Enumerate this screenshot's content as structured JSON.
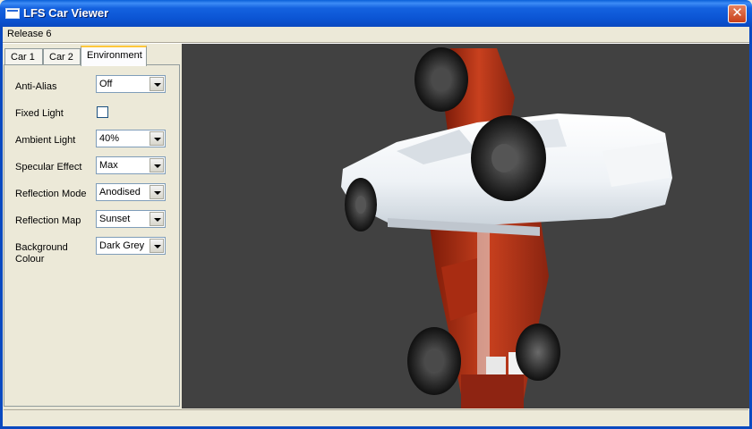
{
  "window": {
    "title": "LFS Car Viewer",
    "close_label": "✕"
  },
  "menu": {
    "release": "Release 6"
  },
  "tabs": [
    {
      "label": "Car 1"
    },
    {
      "label": "Car 2"
    },
    {
      "label": "Environment"
    }
  ],
  "environment": {
    "anti_alias": {
      "label": "Anti-Alias",
      "value": "Off"
    },
    "fixed_light": {
      "label": "Fixed Light",
      "checked": false
    },
    "ambient_light": {
      "label": "Ambient Light",
      "value": "40%"
    },
    "specular_effect": {
      "label": "Specular Effect",
      "value": "Max"
    },
    "reflection_mode": {
      "label": "Reflection Mode",
      "value": "Anodised"
    },
    "reflection_map": {
      "label": "Reflection Map",
      "value": "Sunset"
    },
    "background_colour": {
      "label_line1": "Background",
      "label_line2": "Colour",
      "value": "Dark Grey"
    }
  },
  "colors": {
    "viewport_bg": "#414141",
    "titlebar": "#0A54D3",
    "face": "#ECE9D8"
  }
}
